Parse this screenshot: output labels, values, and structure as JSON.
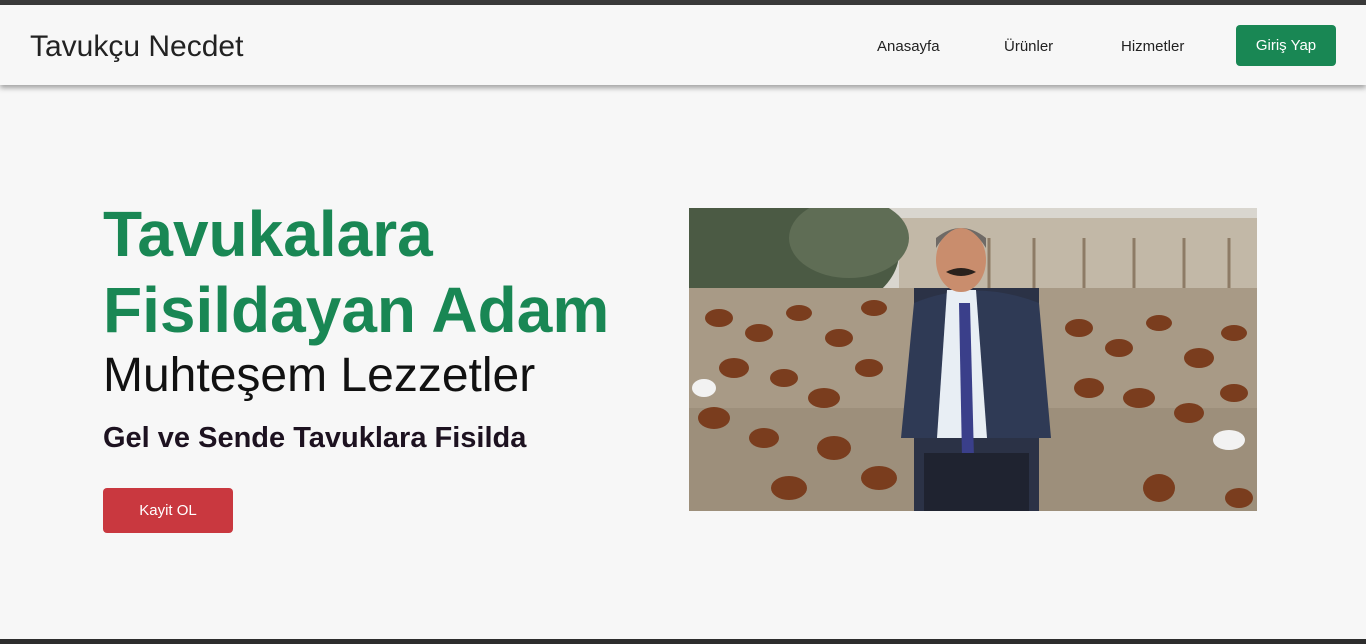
{
  "navbar": {
    "brand": "Tavukçu Necdet",
    "links": [
      {
        "label": "Anasayfa"
      },
      {
        "label": "Ürünler"
      },
      {
        "label": "Hizmetler"
      }
    ],
    "login_label": "Giriş Yap"
  },
  "hero": {
    "title": "Tavukalara Fisildayan Adam",
    "subtitle": "Muhteşem Lezzetler",
    "tagline": "Gel ve Sende Tavuklara Fisilda",
    "signup_label": "Kayit OL",
    "image_icon": "photo-man-with-chickens"
  },
  "colors": {
    "primary_green": "#198754",
    "danger_red": "#c9383f",
    "background": "#f7f7f7"
  }
}
